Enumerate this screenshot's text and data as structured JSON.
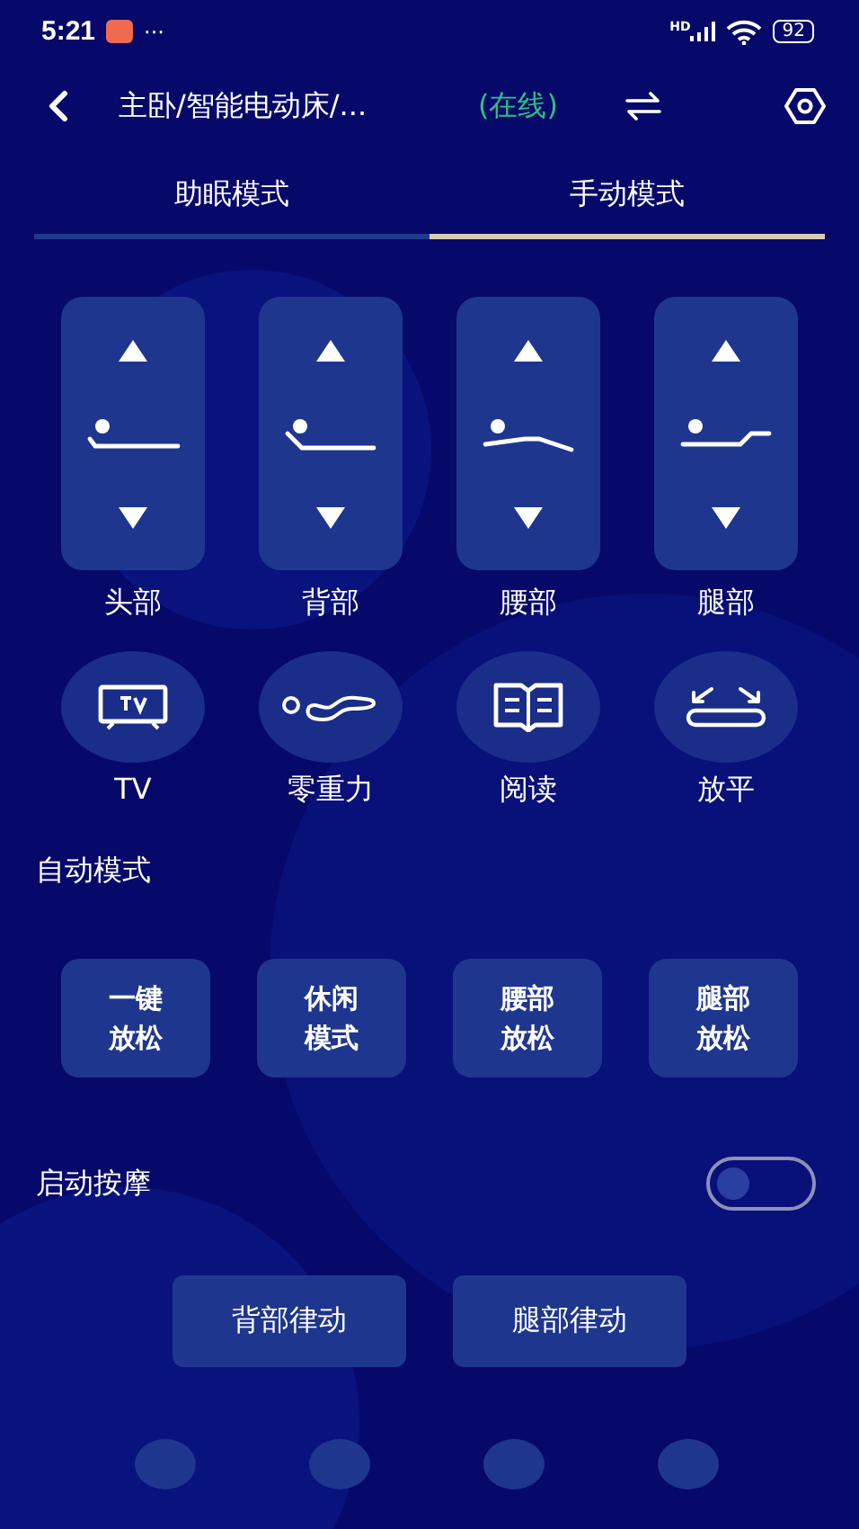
{
  "status_bar": {
    "time": "5:21",
    "more": "···",
    "network": "HD",
    "battery": "92"
  },
  "header": {
    "title": "主卧/智能电动床/...",
    "status": "(在线)"
  },
  "tabs": [
    {
      "label": "助眠模式",
      "selected": false
    },
    {
      "label": "手动模式",
      "selected": true
    }
  ],
  "position_controls": [
    {
      "label": "头部"
    },
    {
      "label": "背部"
    },
    {
      "label": "腰部"
    },
    {
      "label": "腿部"
    }
  ],
  "presets": [
    {
      "label": "TV"
    },
    {
      "label": "零重力"
    },
    {
      "label": "阅读"
    },
    {
      "label": "放平"
    }
  ],
  "auto_mode": {
    "title": "自动模式",
    "buttons": [
      {
        "lines": [
          "一键",
          "放松"
        ]
      },
      {
        "lines": [
          "休闲",
          "模式"
        ]
      },
      {
        "lines": [
          "腰部",
          "放松"
        ]
      },
      {
        "lines": [
          "腿部",
          "放松"
        ]
      }
    ]
  },
  "massage": {
    "label": "启动按摩",
    "on": false,
    "buttons": [
      "背部律动",
      "腿部律动"
    ]
  }
}
